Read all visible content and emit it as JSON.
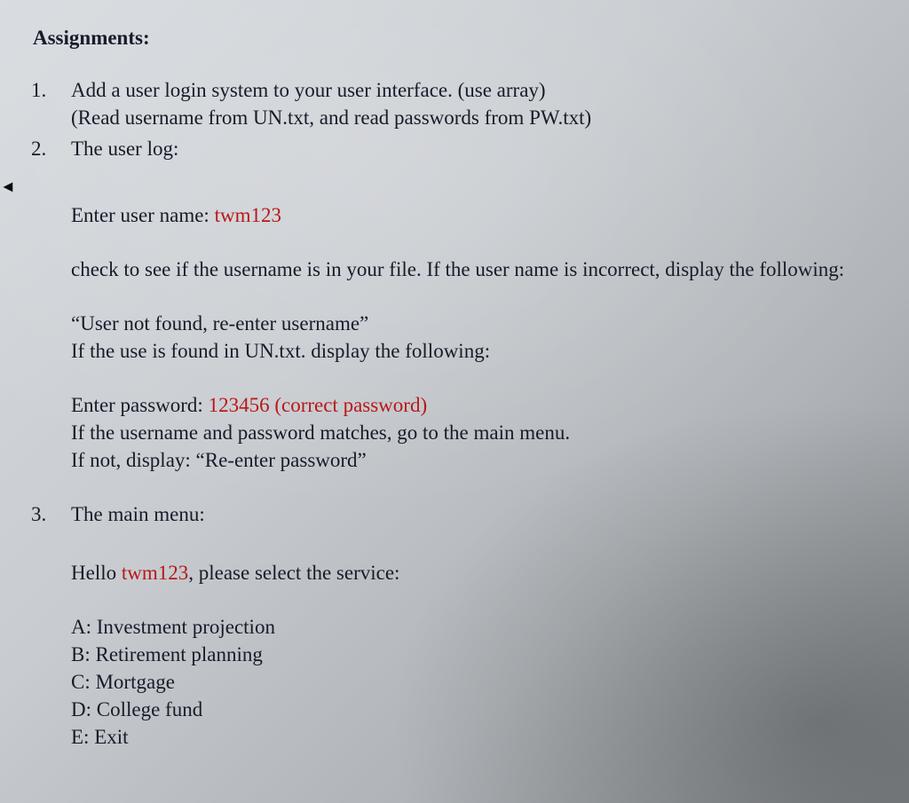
{
  "title": "Assignments:",
  "item1": {
    "num": "1.",
    "line1": "Add a user login system to your user interface. (use array)",
    "line2": "(Read username from UN.txt, and read passwords from PW.txt)"
  },
  "item2": {
    "num": "2.",
    "label": "The user log:",
    "prompt_user": "Enter user name: ",
    "username": "twm123",
    "check_text": "check to see if the username is in your file. If the user name is incorrect, display the following:",
    "not_found": "“User not found, re-enter username”",
    "if_found": "If the use is found in UN.txt. display the following:",
    "prompt_pw": "Enter password: ",
    "password": "123456 (correct password)",
    "match_text": "If the username and password matches, go to the main menu.",
    "reenter": "If not, display: “Re-enter password”"
  },
  "item3": {
    "num": "3.",
    "label": "The main menu:",
    "hello_pre": "Hello ",
    "hello_user": "twm123",
    "hello_post": ", please select the service:",
    "opts": {
      "a": "A: Investment projection",
      "b": "B: Retirement planning",
      "c": "C: Mortgage",
      "d": "D: College fund",
      "e": "E: Exit"
    }
  }
}
